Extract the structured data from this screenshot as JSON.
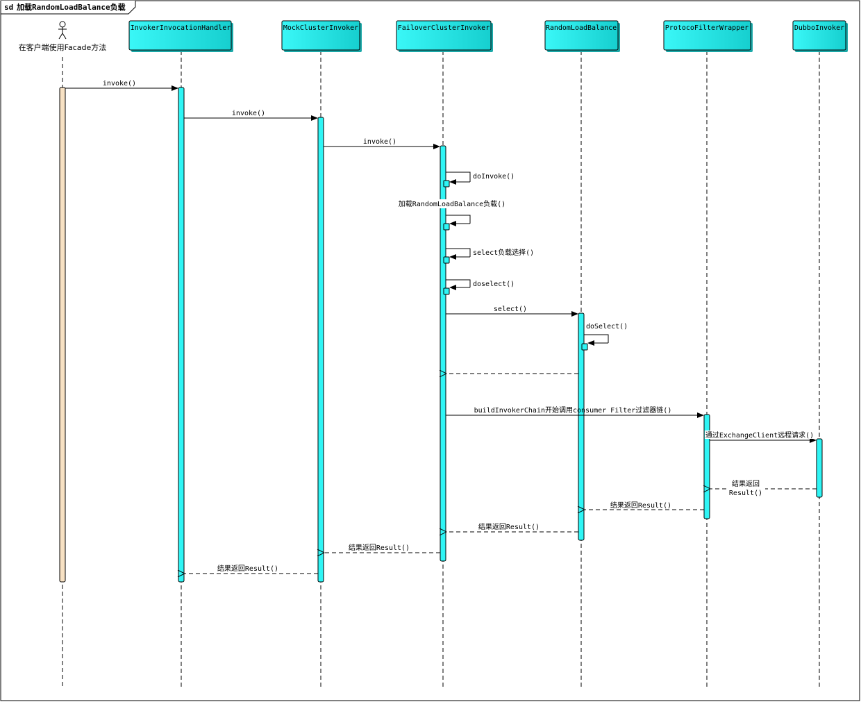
{
  "frame": {
    "keyword": "sd",
    "title": "加载RandomLoadBalance负载"
  },
  "participants": [
    {
      "id": "client",
      "kind": "actor",
      "label": "在客户端使用Facade方法"
    },
    {
      "id": "ih",
      "kind": "box",
      "label": "InvokerInvocationHandler"
    },
    {
      "id": "mock",
      "kind": "box",
      "label": "MockClusterInvoker"
    },
    {
      "id": "failover",
      "kind": "box",
      "label": "FailoverClusterInvoker"
    },
    {
      "id": "rlb",
      "kind": "box",
      "label": "RandomLoadBalance"
    },
    {
      "id": "pfw",
      "kind": "box",
      "label": "ProtocoFilterWrapper"
    },
    {
      "id": "dubbo",
      "kind": "box",
      "label": "DubboInvoker"
    }
  ],
  "messages": [
    {
      "from": "client",
      "to": "ih",
      "label": "invoke()",
      "type": "call"
    },
    {
      "from": "ih",
      "to": "mock",
      "label": "invoke()",
      "type": "call"
    },
    {
      "from": "mock",
      "to": "failover",
      "label": "invoke()",
      "type": "call"
    },
    {
      "from": "failover",
      "to": "failover",
      "label": "doInvoke()",
      "type": "self"
    },
    {
      "from": "failover",
      "to": "failover",
      "label": "加载RandomLoadBalance负载()",
      "type": "self"
    },
    {
      "from": "failover",
      "to": "failover",
      "label": "select负载选择()",
      "type": "self"
    },
    {
      "from": "failover",
      "to": "failover",
      "label": "doselect()",
      "type": "self"
    },
    {
      "from": "failover",
      "to": "rlb",
      "label": "select()",
      "type": "call"
    },
    {
      "from": "rlb",
      "to": "rlb",
      "label": "doSelect()",
      "type": "self"
    },
    {
      "from": "rlb",
      "to": "failover",
      "label": "",
      "type": "return"
    },
    {
      "from": "failover",
      "to": "pfw",
      "label": "buildInvokerChain开始调用consumer Filter过滤器链()",
      "type": "call"
    },
    {
      "from": "pfw",
      "to": "dubbo",
      "label": "通过ExchangeClient远程请求()",
      "type": "call"
    },
    {
      "from": "dubbo",
      "to": "pfw",
      "label": "结果返回\nResult()",
      "type": "return"
    },
    {
      "from": "pfw",
      "to": "rlb",
      "label": "结果返回Result()",
      "type": "return"
    },
    {
      "from": "rlb",
      "to": "failover",
      "label": "结果返回Result()",
      "type": "return"
    },
    {
      "from": "failover",
      "to": "mock",
      "label": "结果返回Result()",
      "type": "return"
    },
    {
      "from": "mock",
      "to": "ih",
      "label": "结果返回Result()",
      "type": "return"
    }
  ],
  "colors": {
    "lifeline_box_fill": "#2ff5f5",
    "lifeline_box_shadow": "#1aa8a8",
    "activation_fill": "#2ff5f5",
    "actor_activation_fill": "#f7e1c3",
    "line": "#000000"
  }
}
